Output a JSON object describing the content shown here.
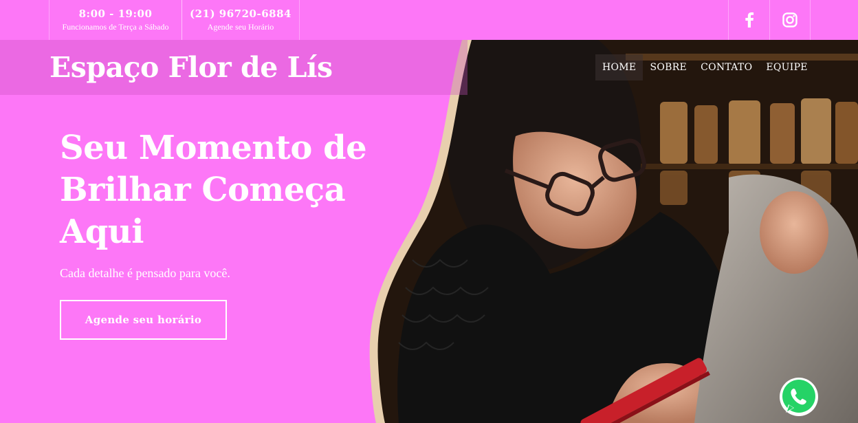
{
  "topbar": {
    "hours": "8:00 - 19:00",
    "hours_note": "Funcionamos de Terça a Sábado",
    "phone": "(21) 96720-6884",
    "phone_note": "Agende seu Horário",
    "social": [
      {
        "icon": "facebook-icon"
      },
      {
        "icon": "instagram-icon"
      }
    ]
  },
  "header": {
    "brand": "Espaço Flor de Lís",
    "nav": [
      {
        "label": "HOME",
        "active": true
      },
      {
        "label": "SOBRE",
        "active": false
      },
      {
        "label": "CONTATO",
        "active": false
      },
      {
        "label": "EQUIPE",
        "active": false
      }
    ]
  },
  "hero": {
    "title_line1": "Seu Momento de",
    "title_line2": "Brilhar Começa",
    "title_line3": "Aqui",
    "subtitle": "Cada detalhe é pensado para você.",
    "cta_label": "Agende seu horário"
  },
  "floating": {
    "icon": "whatsapp-icon"
  },
  "colors": {
    "brand_pink": "#fd77f7",
    "wave_accent": "#e8cfae",
    "whatsapp_green": "#25d366"
  }
}
